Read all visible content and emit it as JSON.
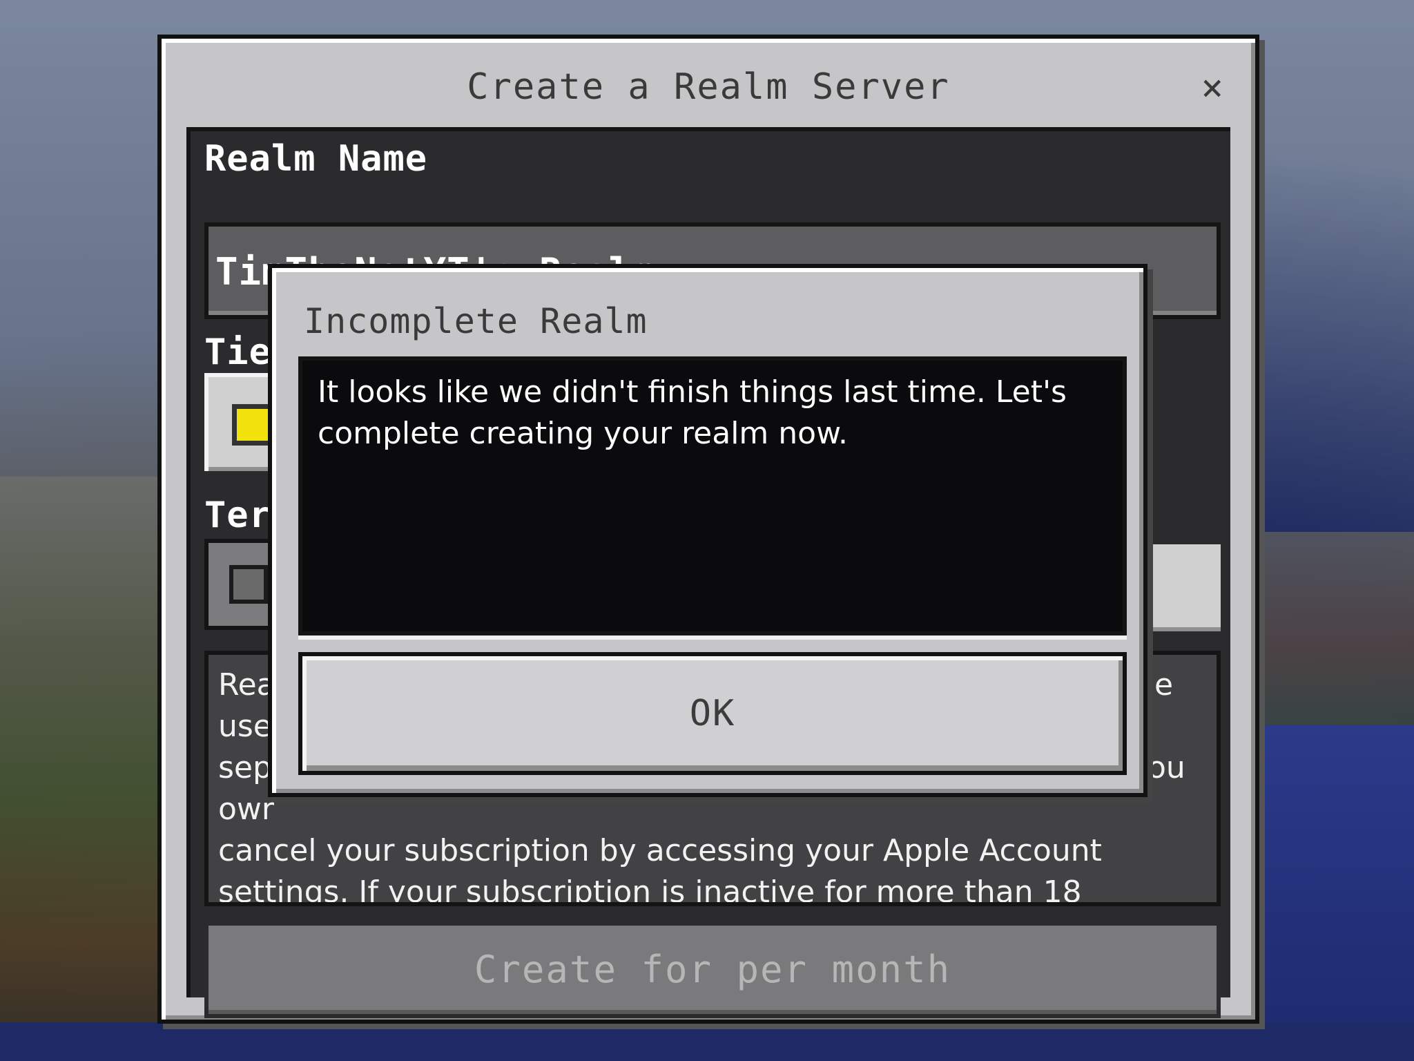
{
  "dialog": {
    "title": "Create a Realm Server",
    "close_label": "×",
    "realm_name_label": "Realm Name",
    "realm_name_value": "TimTheNotYT's Realm",
    "tier_label_partial": "Tier",
    "term_label_partial": "Ter",
    "description_lines": [
      "Rea",
      "use",
      "sep",
      "owr",
      "cancel your subscription by accessing your Apple Account",
      "settings. If your subscription is inactive for more than 18"
    ],
    "description_right_fragments": [
      "e",
      "ou"
    ],
    "create_button_label": "Create for  per month",
    "tier_selected_color": "#f1e20d"
  },
  "modal": {
    "title": "Incomplete Realm",
    "message": "It looks like we didn't finish things last time.  Let's complete creating your realm now.",
    "ok_label": "OK"
  }
}
